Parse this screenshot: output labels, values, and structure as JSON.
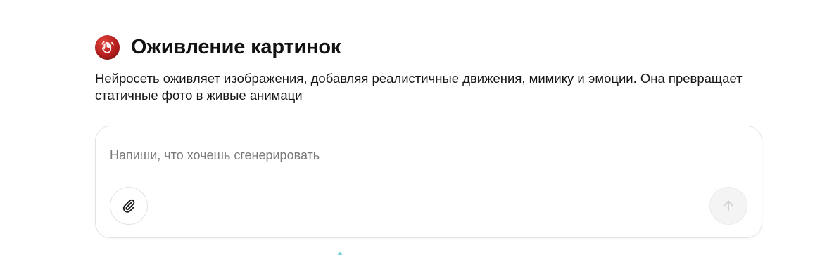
{
  "header": {
    "title": "Оживление картинок",
    "icon": "waving-hand-icon",
    "icon_color": "#c0231f"
  },
  "description": "Нейросеть оживляет изображения, добавляя реалистичные движения, мимику и эмоции. Она превращает статичные фото в живые анимаци",
  "prompt": {
    "value": "",
    "placeholder": "Напиши, что хочешь сгенерировать",
    "attach_icon": "paperclip-icon",
    "send_icon": "arrow-up-icon"
  }
}
